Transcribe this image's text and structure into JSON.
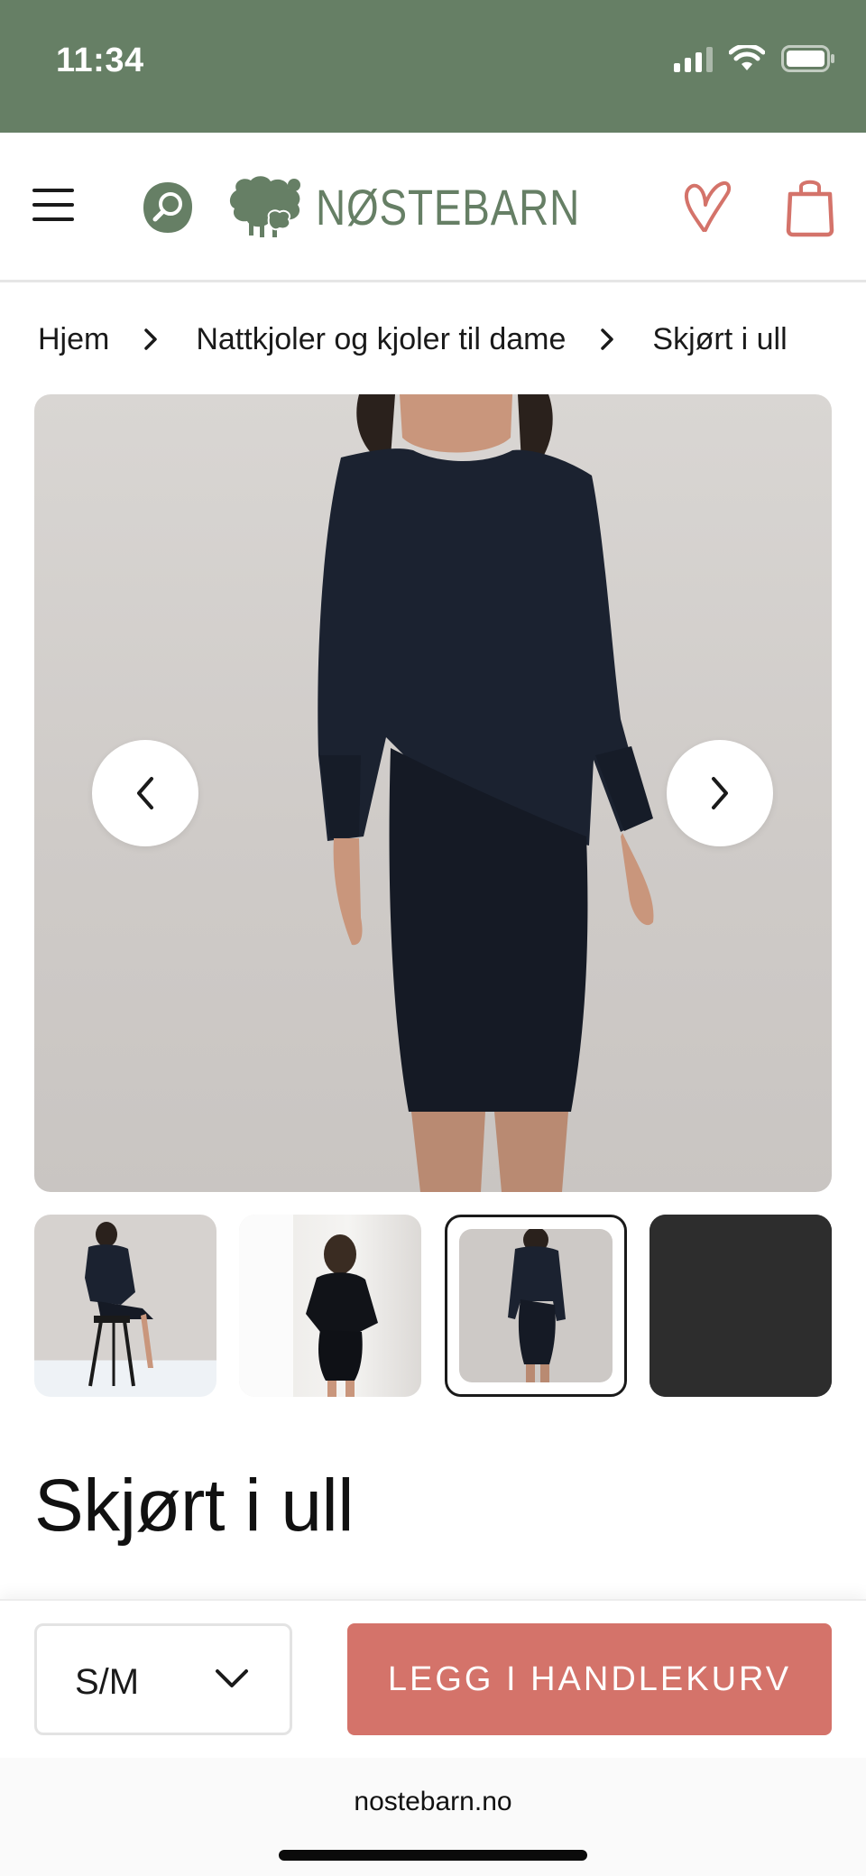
{
  "status_bar": {
    "time": "11:34",
    "background": "#667f65"
  },
  "header": {
    "menu_icon": "hamburger-icon",
    "search_icon": "search-icon",
    "logo_text": "NØSTEBARN",
    "logo_icon": "sheep-logo",
    "wishlist_icon": "heart-icon",
    "cart_icon": "shopping-bag-icon",
    "brand_color": "#667f65",
    "accent_color": "#d4736a"
  },
  "breadcrumb": {
    "items": [
      "Hjem",
      "Nattkjoler og kjoler til dame",
      "Skjørt i ull"
    ],
    "separator_icon": "chevron-right-icon"
  },
  "gallery": {
    "main_image": "woman in black long-sleeve top and black pencil skirt",
    "prev_icon": "chevron-left-icon",
    "next_icon": "chevron-right-icon",
    "thumbnails": [
      {
        "name": "seated-on-stool"
      },
      {
        "name": "standing-window"
      },
      {
        "name": "standing-front"
      },
      {
        "name": "fabric-closeup"
      }
    ],
    "active_index": 3
  },
  "product": {
    "title": "Skjørt i ull"
  },
  "purchase_bar": {
    "size_value": "S/M",
    "add_to_cart_label": "LEGG I HANDLEKURV"
  },
  "browser": {
    "url": "nostebarn.no"
  }
}
